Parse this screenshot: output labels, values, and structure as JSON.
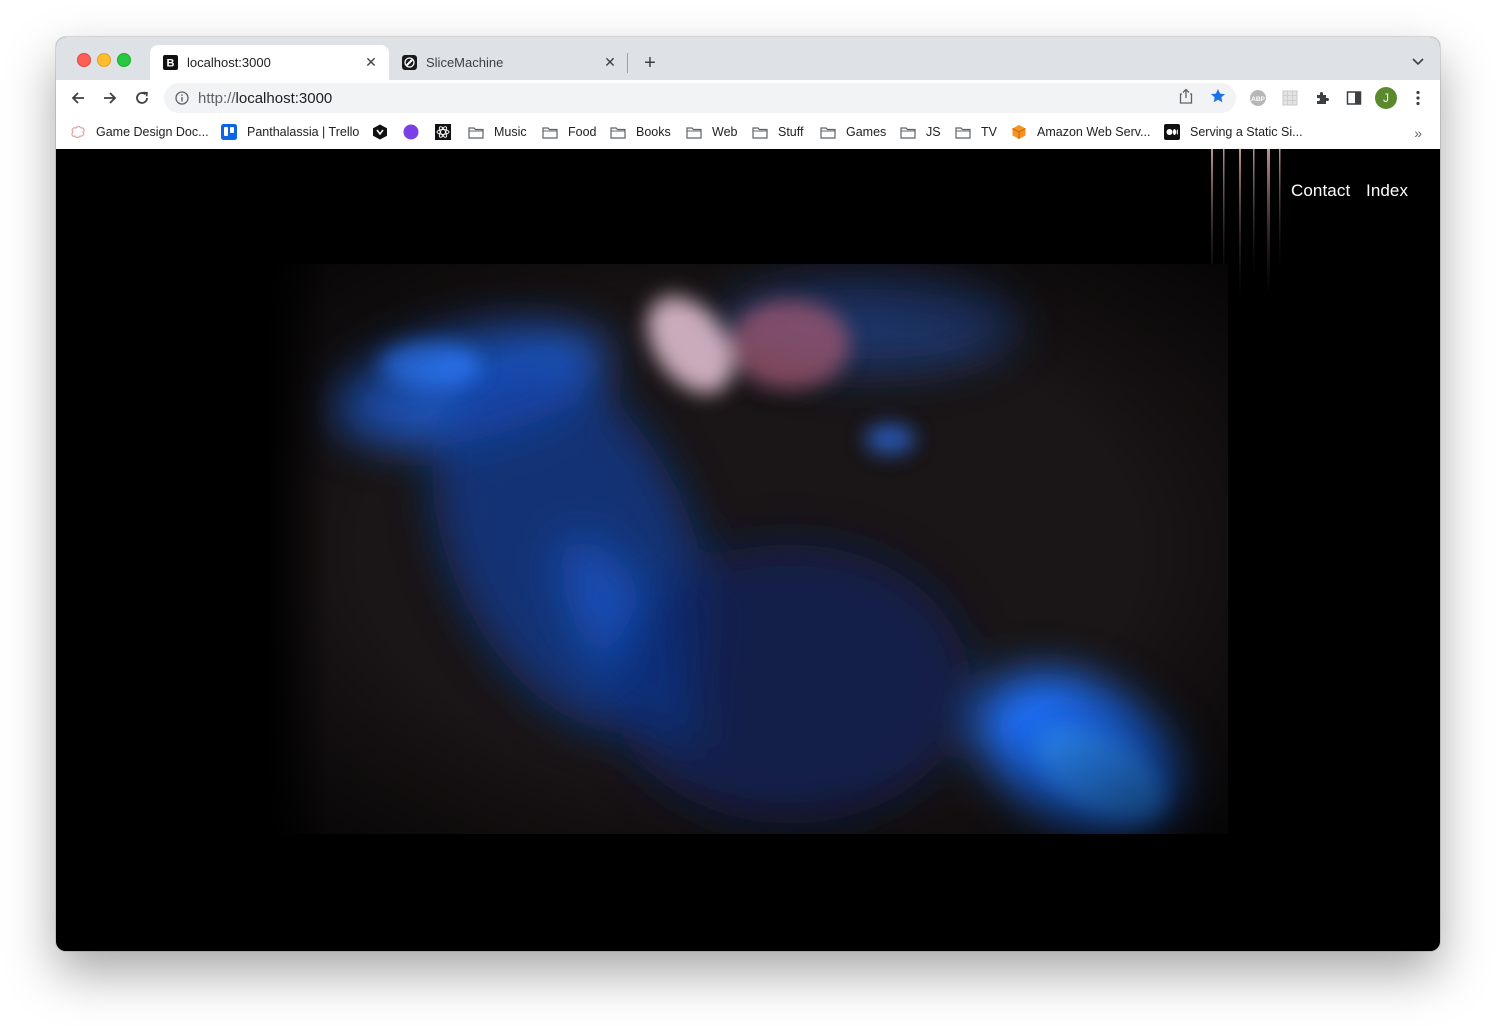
{
  "browser": {
    "tabs": [
      {
        "title": "localhost:3000",
        "favicon": "b-logo-icon",
        "active": true
      },
      {
        "title": "SliceMachine",
        "favicon": "slicemachine-icon",
        "active": false
      }
    ],
    "url_scheme": "http://",
    "url_host": "localhost:3000",
    "avatar_initial": "J"
  },
  "bookmarks": [
    {
      "label": "Game Design Doc...",
      "icon": "brain-icon"
    },
    {
      "label": "Panthalassia | Trello",
      "icon": "trello-icon"
    },
    {
      "label": "",
      "icon": "hexagon-logo-icon"
    },
    {
      "label": "",
      "icon": "purple-circle-icon"
    },
    {
      "label": "",
      "icon": "atom-icon"
    },
    {
      "label": "Music",
      "icon": "folder-icon"
    },
    {
      "label": "Food",
      "icon": "folder-icon"
    },
    {
      "label": "Books",
      "icon": "folder-icon"
    },
    {
      "label": "Web",
      "icon": "folder-icon"
    },
    {
      "label": "Stuff",
      "icon": "folder-icon"
    },
    {
      "label": "Games",
      "icon": "folder-icon"
    },
    {
      "label": "JS",
      "icon": "folder-icon"
    },
    {
      "label": "TV",
      "icon": "folder-icon"
    },
    {
      "label": "Amazon Web Serv...",
      "icon": "aws-cube-icon"
    },
    {
      "label": "Serving a Static Si...",
      "icon": "medium-icon"
    }
  ],
  "site": {
    "nav": {
      "contact": "Contact",
      "index": "Index"
    }
  },
  "colors": {
    "page_bg": "#000000",
    "hero_bg": "#1a1516",
    "hero_blue": "#1e6fe8",
    "hero_pink": "#c87a8a"
  }
}
